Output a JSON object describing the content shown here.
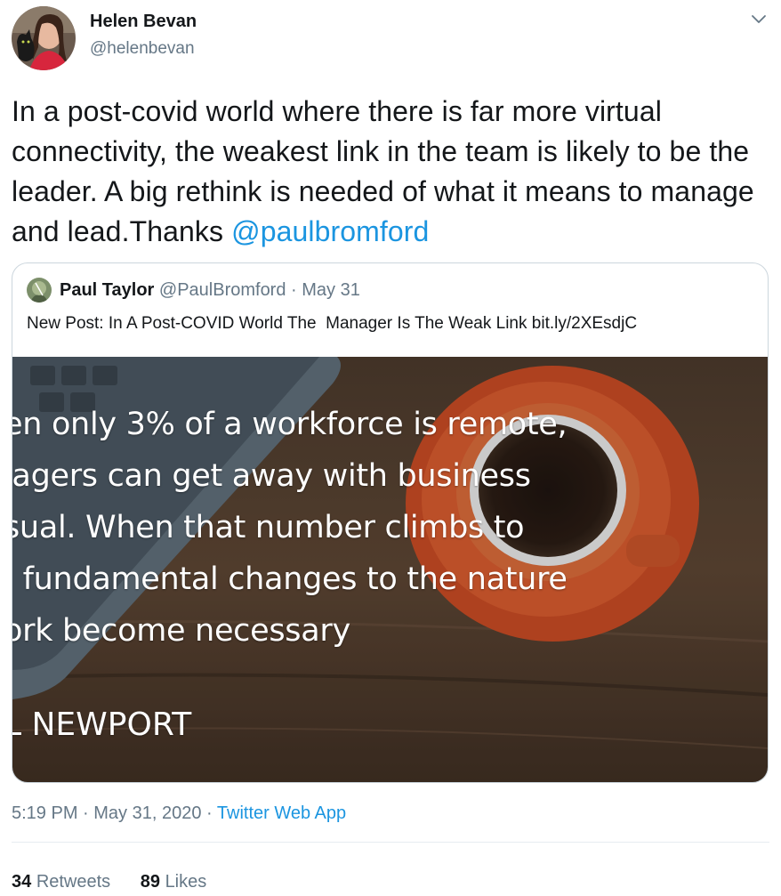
{
  "tweet": {
    "author_name": "Helen Bevan",
    "author_handle": "@helenbevan",
    "text": "In a post-covid world where there is far more virtual connectivity, the weakest link in the team is likely to be the leader. A big rethink is needed of what it means to manage and lead.Thanks ",
    "mention": "@paulbromford",
    "time": "5:19 PM",
    "date": "May 31, 2020",
    "sep": " · ",
    "app": "Twitter Web App"
  },
  "quoted": {
    "name": "Paul Taylor",
    "handle": "@PaulBromford",
    "sep": " · ",
    "date": "May 31",
    "text": "New Post: In A Post-COVID World The  Manager Is The Weak Link bit.ly/2XEsdjC",
    "image_lines": [
      "en only 3% of a workforce is remote,",
      "iagers can get away with business",
      "sual. When that number climbs to",
      ", fundamental changes to the nature",
      "ork become necessary"
    ],
    "image_attribution": "L NEWPORT"
  },
  "stats": {
    "retweets_count": "34",
    "retweets_label": "Retweets",
    "likes_count": "89",
    "likes_label": "Likes"
  },
  "icons": {
    "more": "chevron-down-icon"
  },
  "colors": {
    "link": "#1b95e0",
    "secondary": "#657786",
    "text": "#14171a",
    "border": "#ccd6dd"
  }
}
